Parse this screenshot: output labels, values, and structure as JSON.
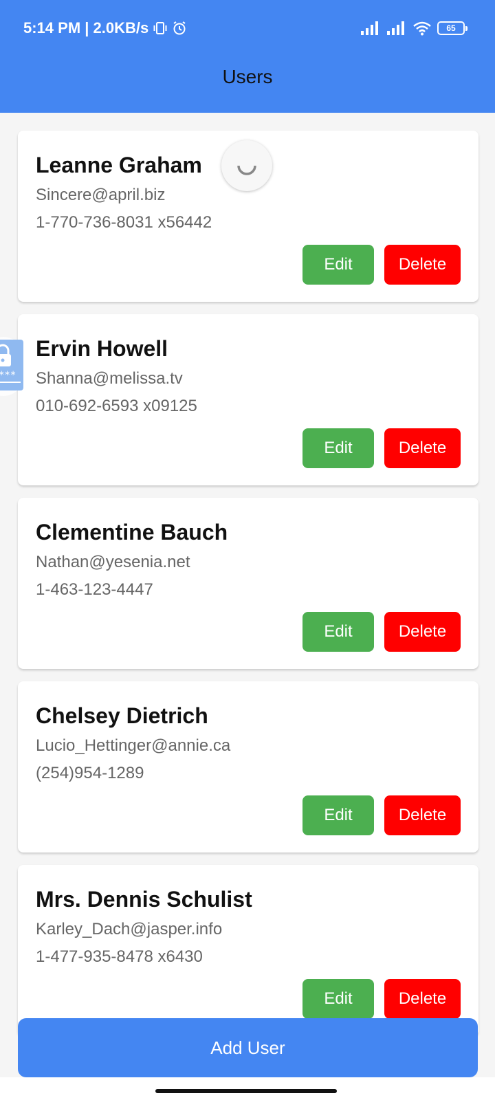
{
  "status_bar": {
    "time_speed": "5:14 PM | 2.0KB/s",
    "battery": "65",
    "icons": [
      "vibrate-icon",
      "alarm-icon",
      "signal-icon",
      "signal-icon",
      "wifi-icon",
      "battery-icon"
    ]
  },
  "header": {
    "title": "Users"
  },
  "users": [
    {
      "name": "Leanne Graham",
      "email": "Sincere@april.biz",
      "phone": "1-770-736-8031 x56442",
      "edit": "Edit",
      "delete": "Delete"
    },
    {
      "name": "Ervin Howell",
      "email": "Shanna@melissa.tv",
      "phone": "010-692-6593 x09125",
      "edit": "Edit",
      "delete": "Delete"
    },
    {
      "name": "Clementine Bauch",
      "email": "Nathan@yesenia.net",
      "phone": "1-463-123-4447",
      "edit": "Edit",
      "delete": "Delete"
    },
    {
      "name": "Chelsey Dietrich",
      "email": "Lucio_Hettinger@annie.ca",
      "phone": "(254)954-1289",
      "edit": "Edit",
      "delete": "Delete"
    },
    {
      "name": "Mrs. Dennis Schulist",
      "email": "Karley_Dach@jasper.info",
      "phone": "1-477-935-8478 x6430",
      "edit": "Edit",
      "delete": "Delete"
    }
  ],
  "add_user": "Add User",
  "colors": {
    "primary": "#4486f2",
    "edit": "#4caf50",
    "delete": "#ff0000",
    "background": "#f5f5f5"
  }
}
